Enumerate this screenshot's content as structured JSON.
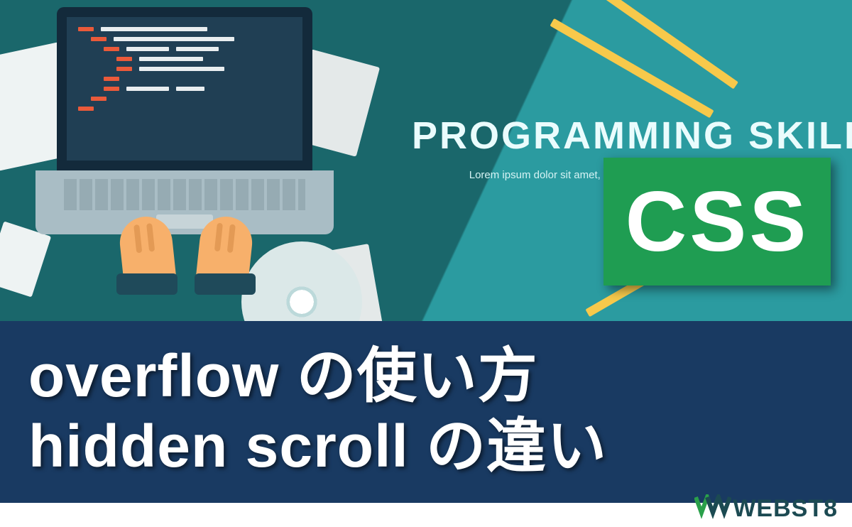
{
  "hero": {
    "title": "PROGRAMMING SKILLS",
    "subtitle": "Lorem ipsum dolor sit amet, cum dam complectitur cu. S ta verta"
  },
  "badge": {
    "label": "CSS"
  },
  "band": {
    "line1": "overflow の使い方",
    "line2": "hidden  scroll の違い"
  },
  "logo": {
    "text": "WEBST8"
  },
  "colors": {
    "teal": "#2b9ba0",
    "darkteal": "#1a676b",
    "green": "#1f9d52",
    "navy": "#193a62"
  }
}
